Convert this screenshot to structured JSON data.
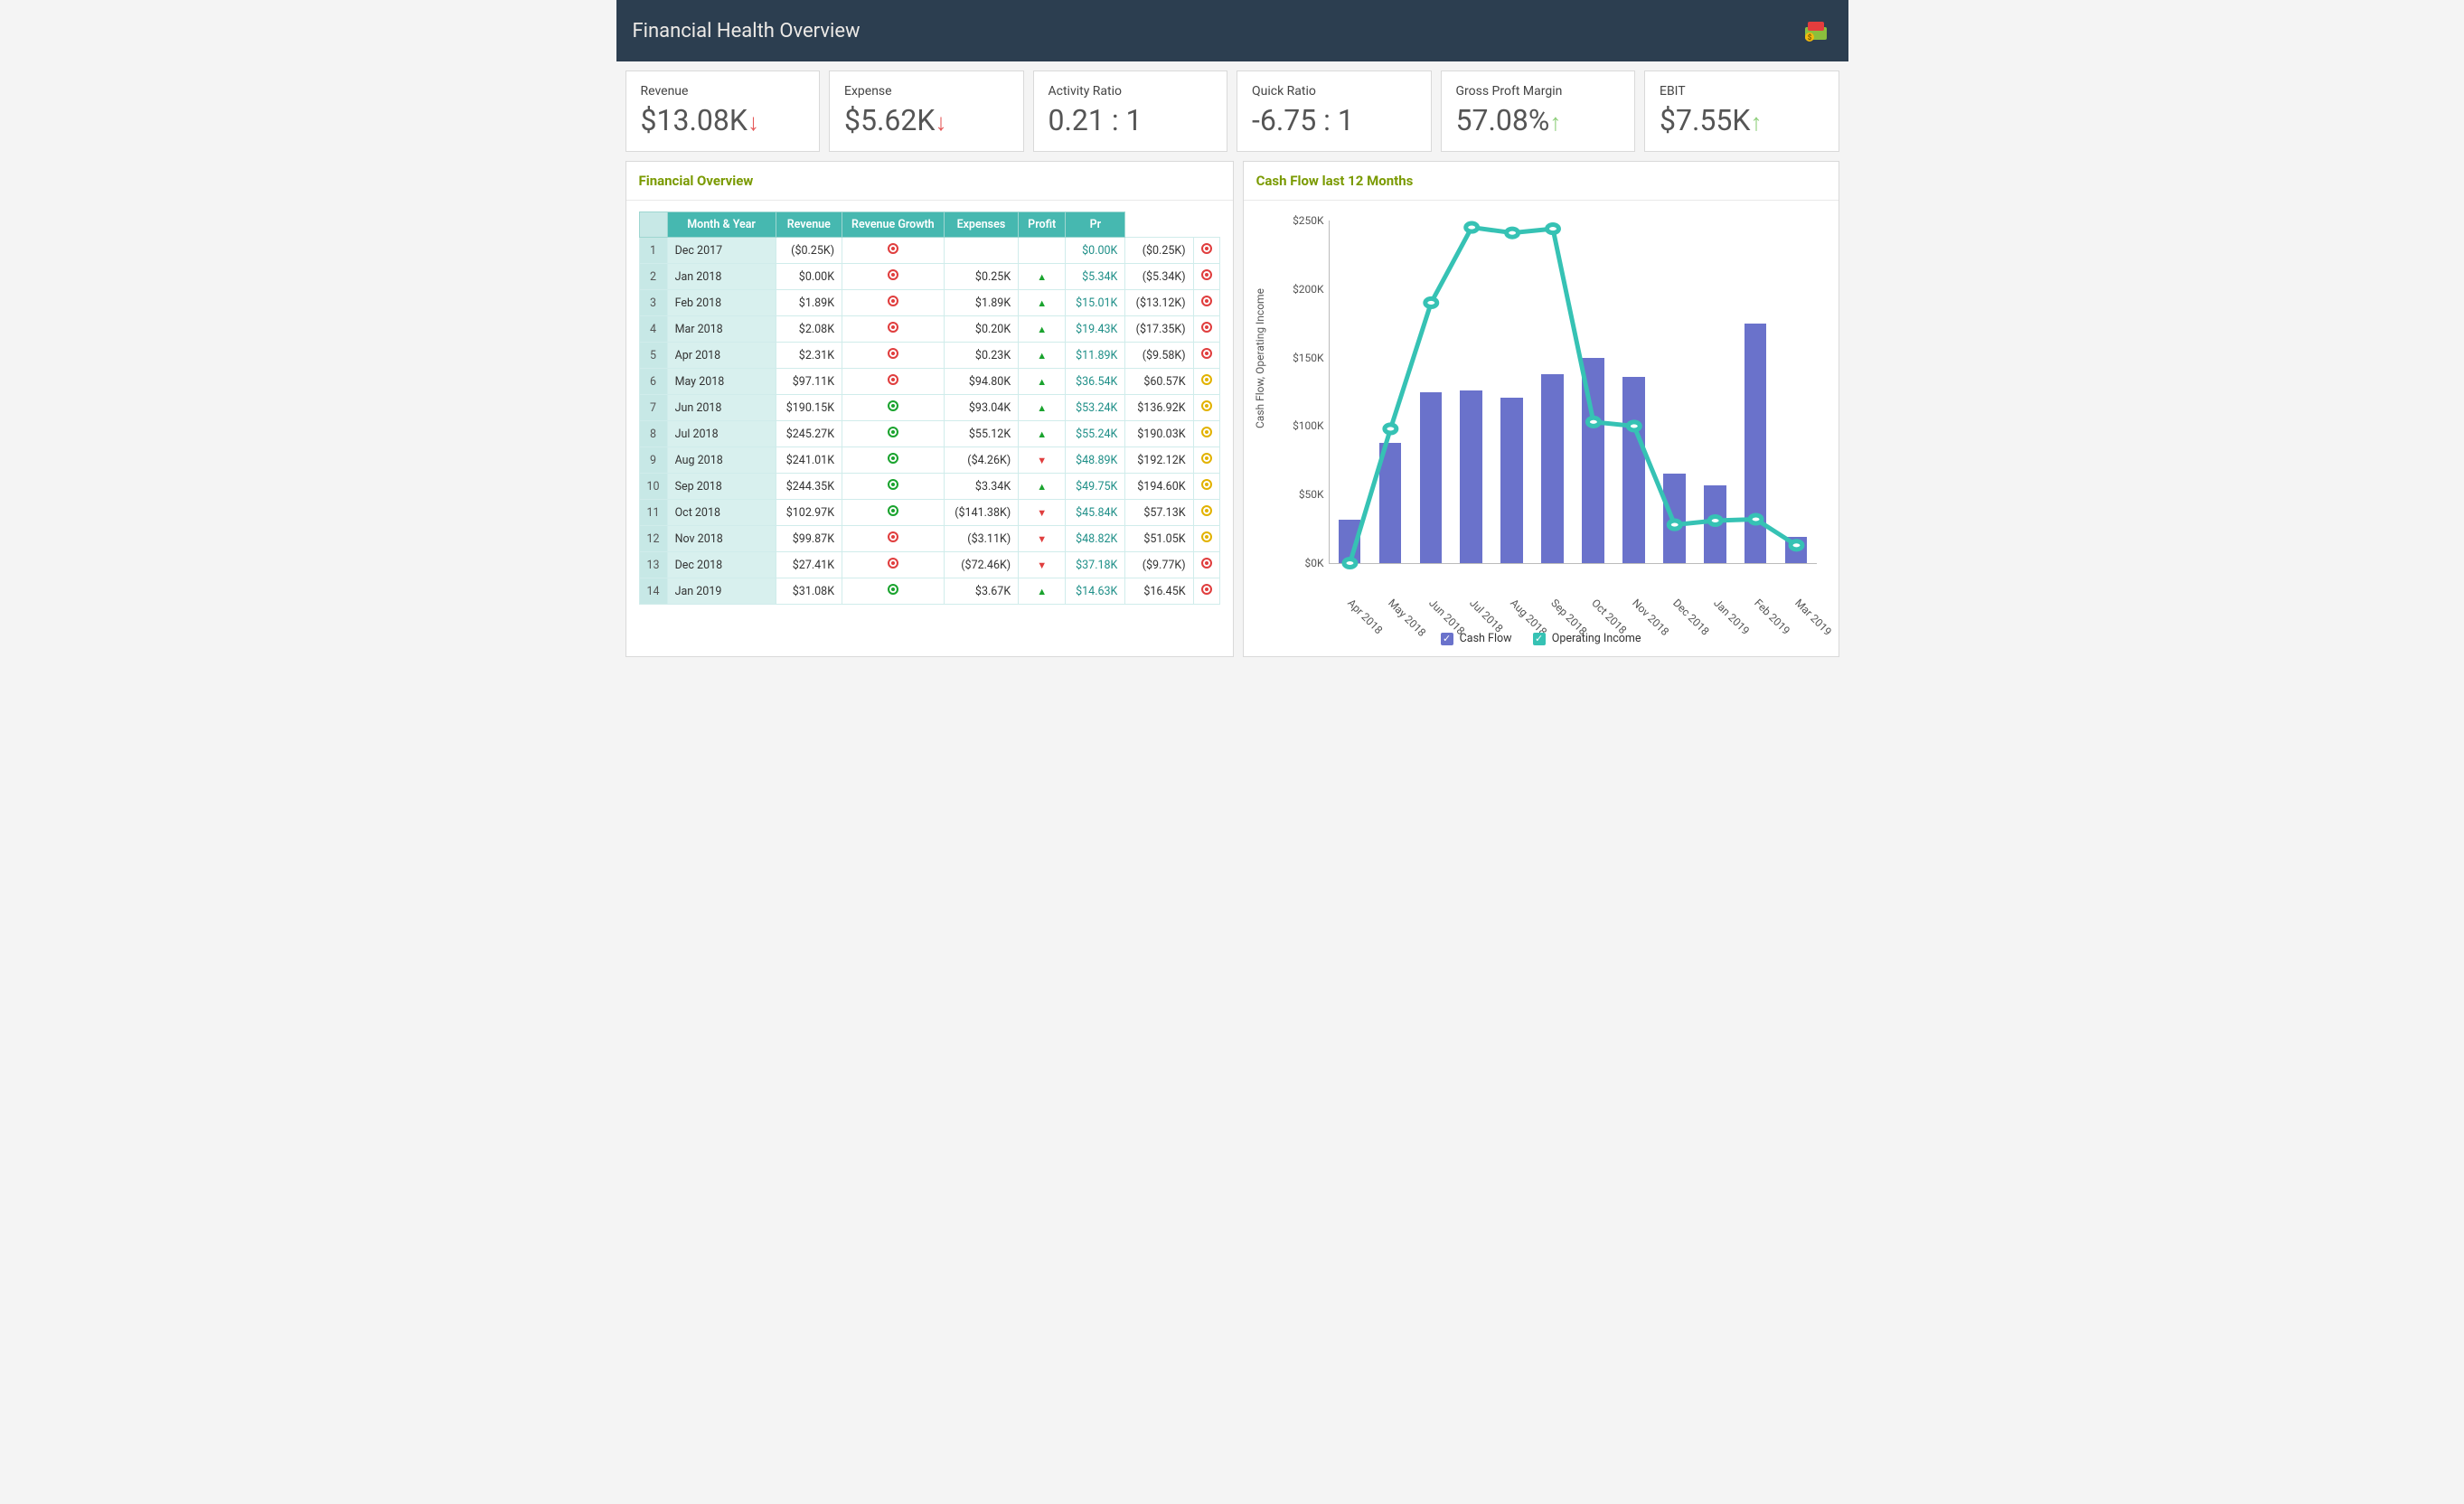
{
  "header": {
    "title": "Financial Health Overview"
  },
  "kpis": [
    {
      "label": "Revenue",
      "value": "$13.08K",
      "trend": "down"
    },
    {
      "label": "Expense",
      "value": "$5.62K",
      "trend": "down"
    },
    {
      "label": "Activity Ratio",
      "value": "0.21 : 1",
      "trend": null
    },
    {
      "label": "Quick Ratio",
      "value": "-6.75 : 1",
      "trend": null
    },
    {
      "label": "Gross Proft Margin",
      "value": "57.08%",
      "trend": "up"
    },
    {
      "label": "EBIT",
      "value": "$7.55K",
      "trend": "up"
    }
  ],
  "financial_overview": {
    "title": "Financial Overview",
    "columns": [
      "Month & Year",
      "Revenue",
      "Revenue Growth",
      "Expenses",
      "Profit",
      "Pr"
    ],
    "rows": [
      {
        "n": 1,
        "month": "Dec 2017",
        "revenue": "($0.25K)",
        "rev_ind": "red",
        "growth": "",
        "growth_dir": "",
        "expenses": "$0.00K",
        "profit": "($0.25K)",
        "prof_ind": "red"
      },
      {
        "n": 2,
        "month": "Jan 2018",
        "revenue": "$0.00K",
        "rev_ind": "red",
        "growth": "$0.25K",
        "growth_dir": "up",
        "expenses": "$5.34K",
        "profit": "($5.34K)",
        "prof_ind": "red"
      },
      {
        "n": 3,
        "month": "Feb 2018",
        "revenue": "$1.89K",
        "rev_ind": "red",
        "growth": "$1.89K",
        "growth_dir": "up",
        "expenses": "$15.01K",
        "profit": "($13.12K)",
        "prof_ind": "red"
      },
      {
        "n": 4,
        "month": "Mar 2018",
        "revenue": "$2.08K",
        "rev_ind": "red",
        "growth": "$0.20K",
        "growth_dir": "up",
        "expenses": "$19.43K",
        "profit": "($17.35K)",
        "prof_ind": "red"
      },
      {
        "n": 5,
        "month": "Apr 2018",
        "revenue": "$2.31K",
        "rev_ind": "red",
        "growth": "$0.23K",
        "growth_dir": "up",
        "expenses": "$11.89K",
        "profit": "($9.58K)",
        "prof_ind": "red"
      },
      {
        "n": 6,
        "month": "May 2018",
        "revenue": "$97.11K",
        "rev_ind": "red",
        "growth": "$94.80K",
        "growth_dir": "up",
        "expenses": "$36.54K",
        "profit": "$60.57K",
        "prof_ind": "yellow"
      },
      {
        "n": 7,
        "month": "Jun 2018",
        "revenue": "$190.15K",
        "rev_ind": "green",
        "growth": "$93.04K",
        "growth_dir": "up",
        "expenses": "$53.24K",
        "profit": "$136.92K",
        "prof_ind": "yellow"
      },
      {
        "n": 8,
        "month": "Jul 2018",
        "revenue": "$245.27K",
        "rev_ind": "green",
        "growth": "$55.12K",
        "growth_dir": "up",
        "expenses": "$55.24K",
        "profit": "$190.03K",
        "prof_ind": "yellow"
      },
      {
        "n": 9,
        "month": "Aug 2018",
        "revenue": "$241.01K",
        "rev_ind": "green",
        "growth": "($4.26K)",
        "growth_dir": "down",
        "expenses": "$48.89K",
        "profit": "$192.12K",
        "prof_ind": "yellow"
      },
      {
        "n": 10,
        "month": "Sep 2018",
        "revenue": "$244.35K",
        "rev_ind": "green",
        "growth": "$3.34K",
        "growth_dir": "up",
        "expenses": "$49.75K",
        "profit": "$194.60K",
        "prof_ind": "yellow"
      },
      {
        "n": 11,
        "month": "Oct 2018",
        "revenue": "$102.97K",
        "rev_ind": "green",
        "growth": "($141.38K)",
        "growth_dir": "down",
        "expenses": "$45.84K",
        "profit": "$57.13K",
        "prof_ind": "yellow"
      },
      {
        "n": 12,
        "month": "Nov 2018",
        "revenue": "$99.87K",
        "rev_ind": "red",
        "growth": "($3.11K)",
        "growth_dir": "down",
        "expenses": "$48.82K",
        "profit": "$51.05K",
        "prof_ind": "yellow"
      },
      {
        "n": 13,
        "month": "Dec 2018",
        "revenue": "$27.41K",
        "rev_ind": "red",
        "growth": "($72.46K)",
        "growth_dir": "down",
        "expenses": "$37.18K",
        "profit": "($9.77K)",
        "prof_ind": "red"
      },
      {
        "n": 14,
        "month": "Jan 2019",
        "revenue": "$31.08K",
        "rev_ind": "green",
        "growth": "$3.67K",
        "growth_dir": "up",
        "expenses": "$14.63K",
        "profit": "$16.45K",
        "prof_ind": "red"
      }
    ]
  },
  "cash_flow_panel": {
    "title": "Cash Flow last 12 Months",
    "y_axis_label": "Cash Flow, Operating Income",
    "legend": {
      "bar": "Cash Flow",
      "line": "Operating Income"
    }
  },
  "chart_data": {
    "type": "bar+line",
    "ylim": [
      0,
      250
    ],
    "y_ticks": [
      "$0K",
      "$50K",
      "$100K",
      "$150K",
      "$200K",
      "$250K"
    ],
    "categories": [
      "Apr 2018",
      "May 2018",
      "Jun 2018",
      "Jul 2018",
      "Aug 2018",
      "Sep 2018",
      "Oct 2018",
      "Nov 2018",
      "Dec 2018",
      "Jan 2019",
      "Feb 2019",
      "Mar 2019"
    ],
    "series": [
      {
        "name": "Cash Flow",
        "kind": "bar",
        "values": [
          32,
          88,
          125,
          126,
          121,
          138,
          150,
          136,
          65,
          57,
          175,
          19
        ]
      },
      {
        "name": "Operating Income",
        "kind": "line",
        "values": [
          0,
          98,
          190,
          245,
          241,
          244,
          103,
          100,
          28,
          31,
          32,
          13
        ]
      }
    ]
  }
}
